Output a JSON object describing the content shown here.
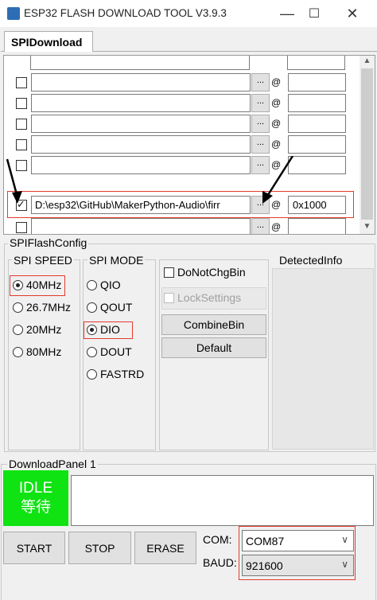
{
  "window": {
    "title": "ESP32 FLASH DOWNLOAD TOOL V3.9.3",
    "minimize": "—",
    "maximize": "☐",
    "close": "✕"
  },
  "tab": {
    "label": "SPIDownload"
  },
  "file_rows": [
    {
      "checked": false,
      "path": "",
      "browse": "...",
      "at": "@",
      "address": ""
    },
    {
      "checked": false,
      "path": "",
      "browse": "...",
      "at": "@",
      "address": ""
    },
    {
      "checked": false,
      "path": "",
      "browse": "...",
      "at": "@",
      "address": ""
    },
    {
      "checked": false,
      "path": "",
      "browse": "...",
      "at": "@",
      "address": ""
    },
    {
      "checked": false,
      "path": "",
      "browse": "...",
      "at": "@",
      "address": ""
    },
    {
      "checked": true,
      "path": "D:\\esp32\\GitHub\\MakerPython-Audio\\firr",
      "browse": "...",
      "at": "@",
      "address": "0x1000"
    },
    {
      "checked": false,
      "path": "",
      "browse": "...",
      "at": "@",
      "address": ""
    }
  ],
  "flash_config": {
    "label": "SPIFlashConfig",
    "spi_speed": {
      "label": "SPI SPEED",
      "options": [
        "40MHz",
        "26.7MHz",
        "20MHz",
        "80MHz"
      ],
      "selected": "40MHz"
    },
    "spi_mode": {
      "label": "SPI MODE",
      "options": [
        "QIO",
        "QOUT",
        "DIO",
        "DOUT",
        "FASTRD"
      ],
      "selected": "DIO"
    },
    "do_not_chg_bin": "DoNotChgBin",
    "lock_settings": "LockSettings",
    "combine_bin": "CombineBin",
    "default": "Default",
    "detected_info": "DetectedInfo"
  },
  "download_panel": {
    "label": "DownloadPanel 1",
    "status_en": "IDLE",
    "status_cn": "等待",
    "start": "START",
    "stop": "STOP",
    "erase": "ERASE",
    "com_label": "COM:",
    "com_value": "COM87",
    "baud_label": "BAUD:",
    "baud_value": "921600"
  },
  "colors": {
    "status_green": "#0fe312",
    "highlight_red": "#e23b2e"
  },
  "icons": {
    "browse": "ellipsis",
    "dropdown": "chevron-down-icon",
    "scroll_up": "chevron-up-icon",
    "scroll_down": "chevron-down-icon"
  }
}
